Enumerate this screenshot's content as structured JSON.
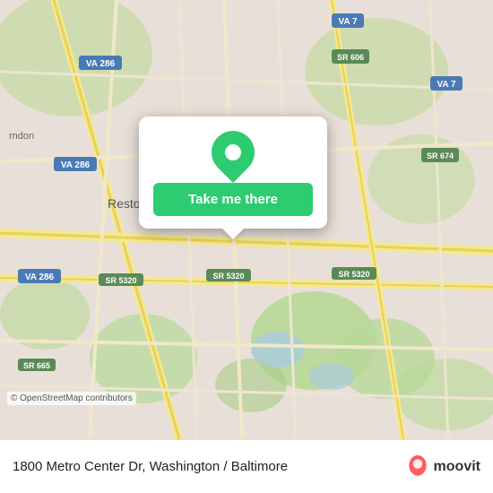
{
  "map": {
    "alt": "Map of Reston, Virginia area showing street map",
    "osm_credit": "© OpenStreetMap contributors",
    "pin_alt": "Location pin"
  },
  "popup": {
    "button_label": "Take me there"
  },
  "bottom_bar": {
    "address": "1800 Metro Center Dr, Washington / Baltimore",
    "moovit_label": "moovit"
  }
}
